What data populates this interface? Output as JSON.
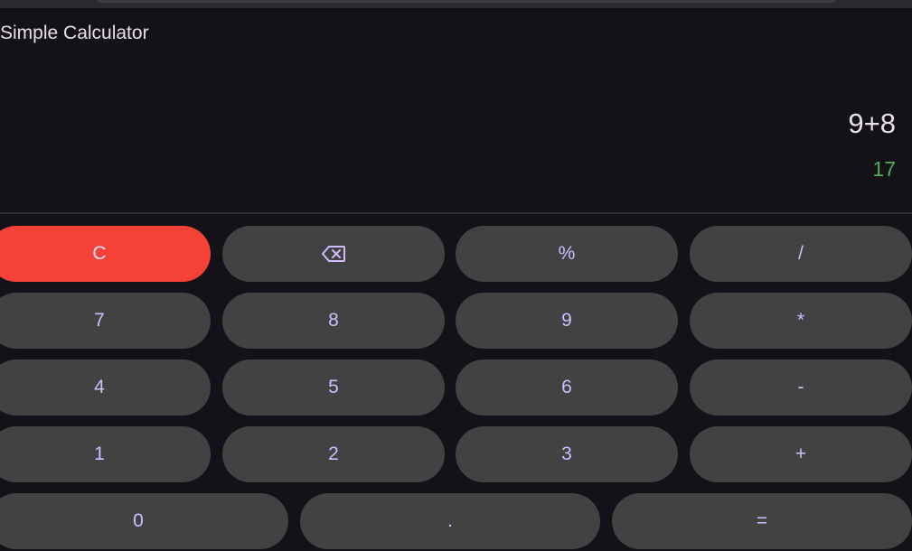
{
  "app": {
    "title": "Simple Calculator"
  },
  "display": {
    "expression": "9+8",
    "result": "17"
  },
  "colors": {
    "background": "#141218",
    "key_background": "#424242",
    "key_text": "#d0bcff",
    "clear_key_background": "#f44336",
    "result_text": "#4caf50",
    "expression_text": "#e6e1e5"
  },
  "keypad": {
    "row1": {
      "clear": "C",
      "backspace_icon": "backspace-icon",
      "percent": "%",
      "divide": "/"
    },
    "row2": {
      "seven": "7",
      "eight": "8",
      "nine": "9",
      "multiply": "*"
    },
    "row3": {
      "four": "4",
      "five": "5",
      "six": "6",
      "minus": "-"
    },
    "row4": {
      "one": "1",
      "two": "2",
      "three": "3",
      "plus": "+"
    },
    "row5": {
      "zero": "0",
      "dot": ".",
      "equals": "="
    }
  }
}
